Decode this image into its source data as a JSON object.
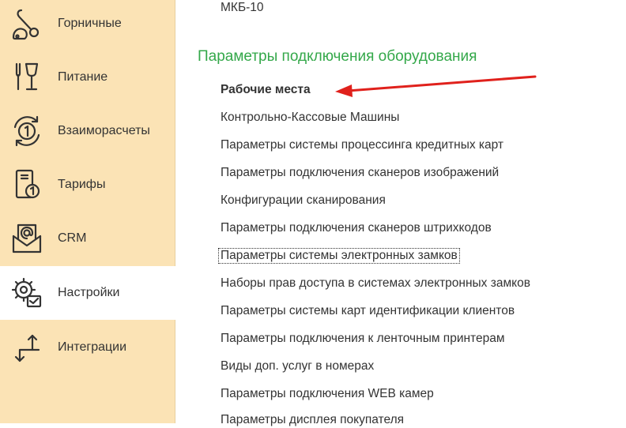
{
  "sidebar": {
    "items": [
      {
        "label": "Горничные",
        "icon": "vacuum-cleaner-icon"
      },
      {
        "label": "Питание",
        "icon": "fork-glass-icon"
      },
      {
        "label": "Взаиморасчеты",
        "icon": "settlement-cycle-icon"
      },
      {
        "label": "Тарифы",
        "icon": "tariff-document-icon"
      },
      {
        "label": "CRM",
        "icon": "crm-mail-icon"
      },
      {
        "label": "Настройки",
        "icon": "settings-gears-icon"
      },
      {
        "label": "Интеграции",
        "icon": "integration-arrows-icon"
      }
    ],
    "active_index": 5
  },
  "content": {
    "top_link": "МКБ-10",
    "section_title": "Параметры подключения оборудования",
    "items": [
      "Рабочие места",
      "Контрольно-Кассовые Машины",
      "Параметры системы процессинга кредитных карт",
      "Параметры подключения сканеров изображений",
      "Конфигурации сканирования",
      "Параметры подключения сканеров штрихкодов",
      "Параметры системы электронных замков",
      "Наборы прав доступа в системах электронных замков",
      "Параметры системы карт идентификации клиентов",
      "Параметры подключения к ленточным принтерам",
      "Виды доп. услуг в номерах",
      "Параметры подключения WEB камер",
      "Параметры дисплея покупателя"
    ],
    "bold_item_index": 0,
    "focused_item_index": 6
  },
  "colors": {
    "sidebar_bg": "#fbe3b5",
    "section_title": "#34a84a",
    "arrow": "#e0211c"
  }
}
